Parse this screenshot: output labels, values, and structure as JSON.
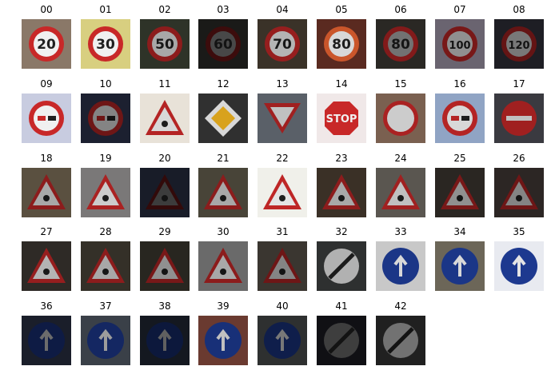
{
  "grid": {
    "labels": [
      "00",
      "01",
      "02",
      "03",
      "04",
      "05",
      "06",
      "07",
      "08",
      "09",
      "10",
      "11",
      "12",
      "13",
      "14",
      "15",
      "16",
      "17",
      "18",
      "19",
      "20",
      "21",
      "22",
      "23",
      "24",
      "25",
      "26",
      "27",
      "28",
      "29",
      "30",
      "31",
      "32",
      "33",
      "34",
      "35",
      "36",
      "37",
      "38",
      "39",
      "40",
      "41",
      "42"
    ],
    "sign_text": {
      "s00": "20",
      "s01": "30",
      "s02": "50",
      "s03": "60",
      "s04": "70",
      "s05": "80",
      "s06": "80",
      "s07": "100",
      "s08": "120",
      "s14": "STOP"
    }
  }
}
